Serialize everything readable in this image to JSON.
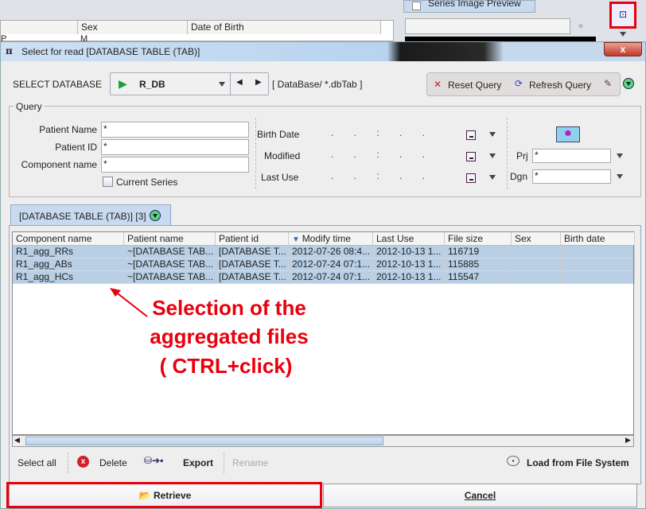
{
  "background": {
    "table_headers": [
      "",
      "Sex",
      "Date of Birth"
    ],
    "row": [
      "P",
      "M",
      ""
    ],
    "preview_tab": "Series Image Preview"
  },
  "dialog": {
    "title": "Select for read [DATABASE TABLE (TAB)]",
    "close": "x",
    "select_database_label": "SELECT DATABASE",
    "database": "R_DB",
    "database_path": "[ DataBase/ *.dbTab ]",
    "reset_query": "Reset Query",
    "refresh_query": "Refresh Query",
    "query": {
      "group_label": "Query",
      "patient_name_label": "Patient Name",
      "patient_name": "*",
      "patient_id_label": "Patient ID",
      "patient_id": "*",
      "component_name_label": "Component name",
      "component_name": "*",
      "current_series": "Current Series",
      "birth_date_label": "Birth Date",
      "modified_label": "Modified",
      "last_use_label": "Last Use",
      "date_placeholder": ".   .   :   .   .",
      "prj_label": "Prj",
      "prj": "*",
      "dgn_label": "Dgn",
      "dgn": "*"
    },
    "tab_label": "[DATABASE TABLE (TAB)] [3]",
    "table": {
      "columns": [
        "Component name",
        "Patient name",
        "Patient id",
        "Modify time",
        "Last Use",
        "File size",
        "Sex",
        "Birth date"
      ],
      "sort_column": "Modify time",
      "rows": [
        [
          "R1_agg_RRs",
          "~[DATABASE TAB...",
          "[DATABASE T...",
          "2012-07-26 08:4...",
          "2012-10-13 1...",
          "116719",
          "",
          ""
        ],
        [
          "R1_agg_ABs",
          "~[DATABASE TAB...",
          "[DATABASE T...",
          "2012-07-24 07:1...",
          "2012-10-13 1...",
          "115885",
          "",
          ""
        ],
        [
          "R1_agg_HCs",
          "~[DATABASE TAB...",
          "[DATABASE T...",
          "2012-07-24 07:1...",
          "2012-10-13 1...",
          "115547",
          "",
          ""
        ]
      ]
    },
    "toolbar": {
      "select_all": "Select all",
      "delete": "Delete",
      "export": "Export",
      "rename": "Rename",
      "load_fs": "Load from File System"
    },
    "retrieve": "Retrieve",
    "cancel": "Cancel"
  },
  "annotation": {
    "line1": "Selection of the",
    "line2": "aggregated files",
    "line3": "( CTRL+click)",
    "color": "#e8000d"
  }
}
